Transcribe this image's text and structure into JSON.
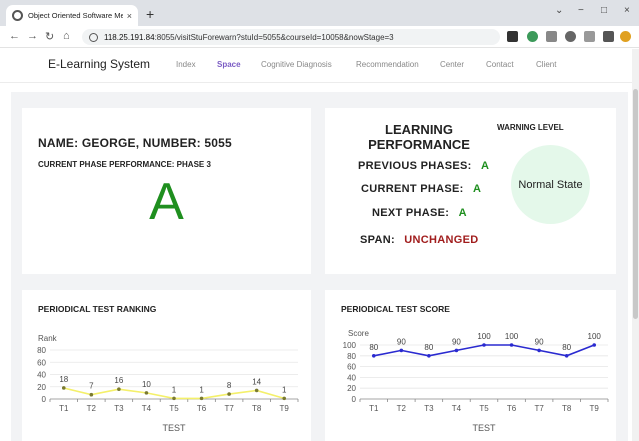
{
  "browser": {
    "tab_title": "Object Oriented Software Metho",
    "tab_close": "×",
    "new_tab": "+",
    "win_min": "−",
    "win_max": "□",
    "win_close": "×",
    "win_chevron": "⌄",
    "url_host": "118.25.191.84",
    "url_rest": ":8055/visitStuForewarn?stuId=5055&courseId=10058&nowStage=3"
  },
  "app": {
    "brand": "E-Learning System",
    "nav": [
      "Index",
      "Space",
      "Cognitive Diagnosis",
      "Recommendation",
      "Center",
      "Contact",
      "Client"
    ],
    "active_nav": "Space"
  },
  "student_card": {
    "name_line": "NAME:  GEORGE, NUMBER: 5055",
    "phase_line": "CURRENT PHASE PERFORMANCE: PHASE 3",
    "grade": "A"
  },
  "performance_card": {
    "title_line1": "LEARNING",
    "title_line2": "PERFORMANCE",
    "warning_title": "WARNING LEVEL",
    "previous_label": "PREVIOUS PHASES:",
    "previous_value": "A",
    "current_label": "CURRENT PHASE:",
    "current_value": "A",
    "next_label": "NEXT PHASE:",
    "next_value": "A",
    "span_label": "SPAN:",
    "span_value": "UNCHANGED",
    "state": "Normal State"
  },
  "chart_data": [
    {
      "type": "line",
      "title": "PERIODICAL TEST RANKING",
      "ylabel": "Rank",
      "xlabel": "TEST",
      "categories": [
        "T1",
        "T2",
        "T3",
        "T4",
        "T5",
        "T6",
        "T7",
        "T8",
        "T9"
      ],
      "values": [
        18,
        7,
        16,
        10,
        1,
        1,
        8,
        14,
        1
      ],
      "yticks": [
        0,
        20,
        40,
        60,
        80
      ],
      "ylim": [
        0,
        80
      ],
      "line_color": "#f4f06a",
      "point_color": "#7a7a30",
      "grid": true
    },
    {
      "type": "line",
      "title": "PERIODICAL TEST SCORE",
      "ylabel": "Score",
      "xlabel": "TEST",
      "categories": [
        "T1",
        "T2",
        "T3",
        "T4",
        "T5",
        "T6",
        "T7",
        "T8",
        "T9"
      ],
      "values": [
        80,
        90,
        80,
        90,
        100,
        100,
        90,
        80,
        100
      ],
      "yticks": [
        0,
        20,
        40,
        60,
        80,
        100
      ],
      "ylim": [
        0,
        100
      ],
      "line_color": "#2a2ad0",
      "point_color": "#2a2ad0",
      "grid": true
    }
  ]
}
